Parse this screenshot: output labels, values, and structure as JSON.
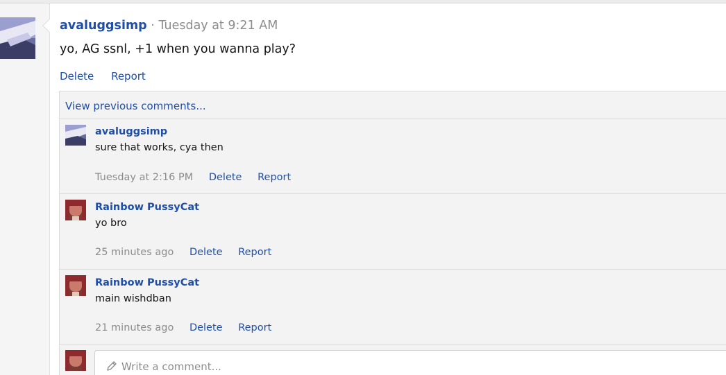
{
  "post": {
    "author": "avaluggsimp",
    "separator": "·",
    "time": "Tuesday at 9:21 AM",
    "body": "yo, AG ssnl, +1 when you wanna play?",
    "delete_label": "Delete",
    "report_label": "Report"
  },
  "comments": {
    "view_previous": "View previous comments...",
    "items": [
      {
        "author": "avaluggsimp",
        "text": "sure that works, cya then",
        "time": "Tuesday at 2:16 PM",
        "delete_label": "Delete",
        "report_label": "Report"
      },
      {
        "author": "Rainbow PussyCat",
        "text": "yo bro",
        "time": "25 minutes ago",
        "delete_label": "Delete",
        "report_label": "Report"
      },
      {
        "author": "Rainbow PussyCat",
        "text": "main wishdban",
        "time": "21 minutes ago",
        "delete_label": "Delete",
        "report_label": "Report"
      }
    ],
    "write_placeholder": "Write a comment..."
  },
  "colors": {
    "link": "#1f4fa6",
    "muted": "#8c8c8c",
    "panel_bg": "#f3f3f3"
  },
  "icons": {
    "pencil": "pencil-icon"
  }
}
